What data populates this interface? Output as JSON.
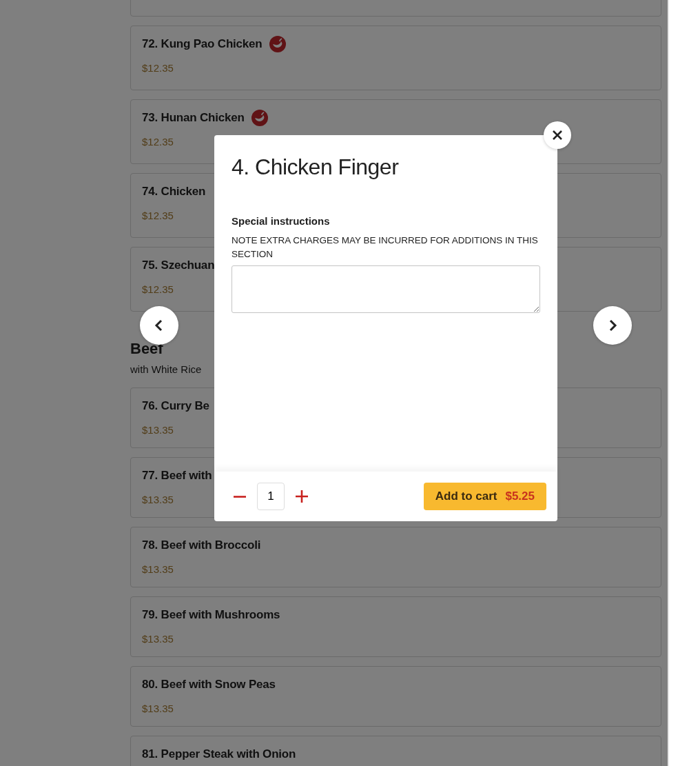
{
  "menu": [
    {
      "kind": "item"
    },
    {
      "kind": "item",
      "name": "72. Kung Pao Chicken",
      "price": "$12.35",
      "spicy": true
    },
    {
      "kind": "item",
      "name": "73. Hunan Chicken",
      "price": "$12.35",
      "spicy": true
    },
    {
      "kind": "item",
      "name": "74. Chicken",
      "price": "$12.35",
      "spicy": false
    },
    {
      "kind": "item",
      "name": "75. Szechuan",
      "price": "$12.35",
      "spicy": false
    },
    {
      "kind": "section",
      "title": "Beef",
      "subtitle": "with White Rice"
    },
    {
      "kind": "item",
      "name": "76. Curry Be",
      "price": "$13.35",
      "spicy": false
    },
    {
      "kind": "item",
      "name": "77. Beef with",
      "price": "$13.35",
      "spicy": false
    },
    {
      "kind": "item",
      "name": "78. Beef with Broccoli",
      "price": "$13.35",
      "spicy": false
    },
    {
      "kind": "item",
      "name": "79. Beef with Mushrooms",
      "price": "$13.35",
      "spicy": false
    },
    {
      "kind": "item",
      "name": "80. Beef with Snow Peas",
      "price": "$13.35",
      "spicy": false
    },
    {
      "kind": "item",
      "name": "81. Pepper Steak with Onion",
      "spicy": false
    }
  ],
  "modal": {
    "title": "4. Chicken Finger",
    "instructions_label": "Special instructions",
    "note": "NOTE EXTRA CHARGES MAY BE INCURRED FOR ADDITIONS IN THIS SECTION",
    "quantity": "1",
    "add_button": "Add to cart",
    "price": "$5.25"
  }
}
